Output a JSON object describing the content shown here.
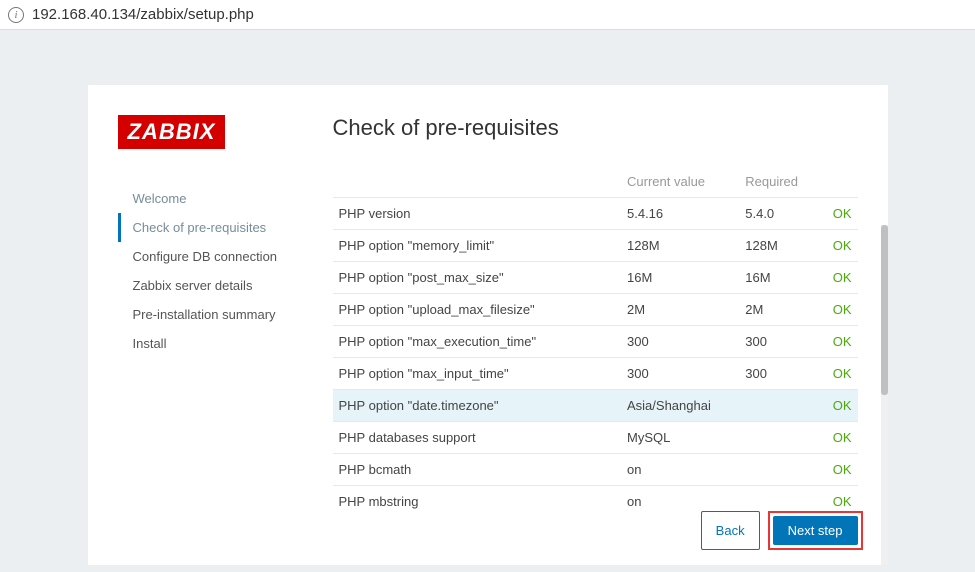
{
  "browser": {
    "url": "192.168.40.134/zabbix/setup.php"
  },
  "logo": "ZABBIX",
  "sidebar": {
    "items": [
      {
        "label": "Welcome",
        "state": "completed"
      },
      {
        "label": "Check of pre-requisites",
        "state": "active"
      },
      {
        "label": "Configure DB connection",
        "state": ""
      },
      {
        "label": "Zabbix server details",
        "state": ""
      },
      {
        "label": "Pre-installation summary",
        "state": ""
      },
      {
        "label": "Install",
        "state": ""
      }
    ]
  },
  "main": {
    "title": "Check of pre-requisites",
    "headers": {
      "current": "Current value",
      "required": "Required"
    },
    "rows": [
      {
        "name": "PHP version",
        "current": "5.4.16",
        "required": "5.4.0",
        "status": "OK",
        "highlight": false
      },
      {
        "name": "PHP option \"memory_limit\"",
        "current": "128M",
        "required": "128M",
        "status": "OK",
        "highlight": false
      },
      {
        "name": "PHP option \"post_max_size\"",
        "current": "16M",
        "required": "16M",
        "status": "OK",
        "highlight": false
      },
      {
        "name": "PHP option \"upload_max_filesize\"",
        "current": "2M",
        "required": "2M",
        "status": "OK",
        "highlight": false
      },
      {
        "name": "PHP option \"max_execution_time\"",
        "current": "300",
        "required": "300",
        "status": "OK",
        "highlight": false
      },
      {
        "name": "PHP option \"max_input_time\"",
        "current": "300",
        "required": "300",
        "status": "OK",
        "highlight": false
      },
      {
        "name": "PHP option \"date.timezone\"",
        "current": "Asia/Shanghai",
        "required": "",
        "status": "OK",
        "highlight": true
      },
      {
        "name": "PHP databases support",
        "current": "MySQL",
        "required": "",
        "status": "OK",
        "highlight": false
      },
      {
        "name": "PHP bcmath",
        "current": "on",
        "required": "",
        "status": "OK",
        "highlight": false
      },
      {
        "name": "PHP mbstring",
        "current": "on",
        "required": "",
        "status": "OK",
        "highlight": false
      }
    ]
  },
  "buttons": {
    "back": "Back",
    "next": "Next step"
  }
}
